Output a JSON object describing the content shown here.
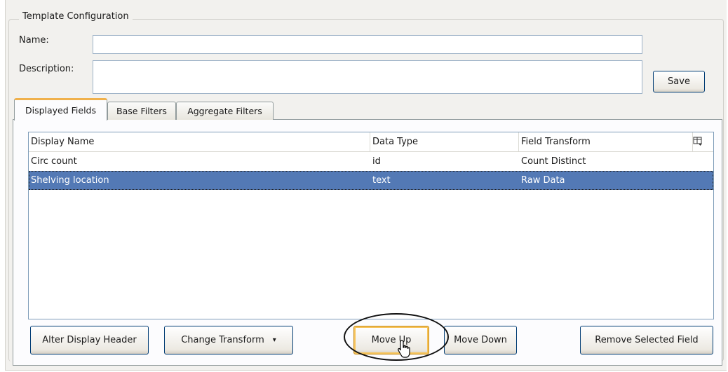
{
  "group": {
    "title": "Template Configuration"
  },
  "form": {
    "name_label": "Name:",
    "name_value": "",
    "description_label": "Description:",
    "description_value": "",
    "save_label": "Save"
  },
  "tabs": [
    {
      "label": "Displayed Fields",
      "active": true
    },
    {
      "label": "Base Filters",
      "active": false
    },
    {
      "label": "Aggregate Filters",
      "active": false
    }
  ],
  "table": {
    "columns": [
      "Display Name",
      "Data Type",
      "Field Transform"
    ],
    "column_picker_icon": "column-chooser-icon",
    "rows": [
      {
        "display_name": "Circ count",
        "data_type": "id",
        "field_transform": "Count Distinct",
        "selected": false
      },
      {
        "display_name": "Shelving location",
        "data_type": "text",
        "field_transform": "Raw Data",
        "selected": true
      }
    ]
  },
  "buttons": {
    "alter_display_header": "Alter Display Header",
    "change_transform": "Change Transform",
    "change_transform_arrow": "▾",
    "move_up": "Move Up",
    "move_down": "Move Down",
    "remove_selected_field": "Remove Selected Field"
  },
  "colors": {
    "selection": "#5379b5",
    "active_tab_accent": "#f0b14c",
    "button_border": "#003c74"
  }
}
